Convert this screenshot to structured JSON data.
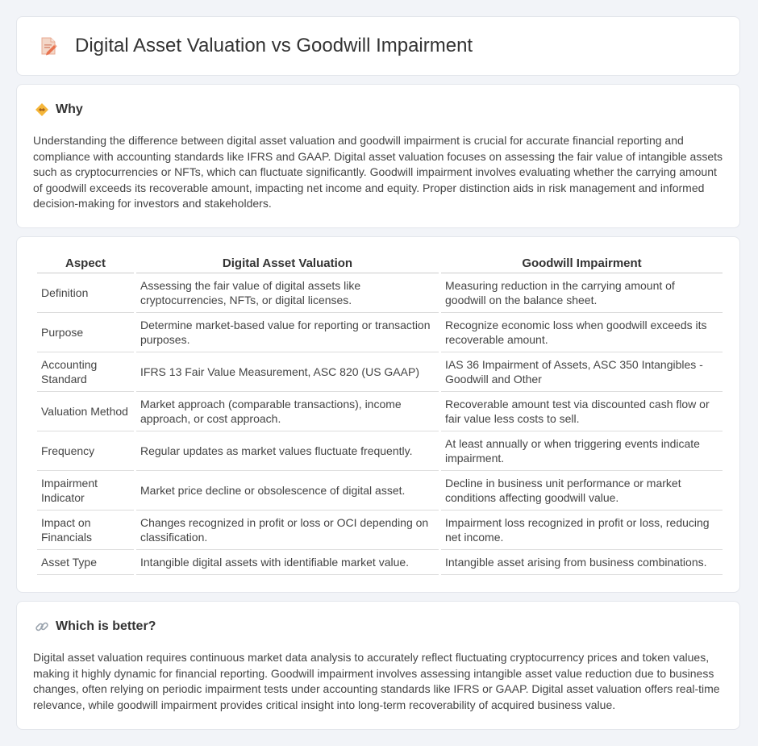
{
  "header": {
    "title": "Digital Asset Valuation vs Goodwill Impairment",
    "icon": "document-pencil-icon"
  },
  "why": {
    "title": "Why",
    "icon": "diamond-handshake-icon",
    "body": "Understanding the difference between digital asset valuation and goodwill impairment is crucial for accurate financial reporting and compliance with accounting standards like IFRS and GAAP. Digital asset valuation focuses on assessing the fair value of intangible assets such as cryptocurrencies or NFTs, which can fluctuate significantly. Goodwill impairment involves evaluating whether the carrying amount of goodwill exceeds its recoverable amount, impacting net income and equity. Proper distinction aids in risk management and informed decision-making for investors and stakeholders."
  },
  "table": {
    "headers": [
      "Aspect",
      "Digital Asset Valuation",
      "Goodwill Impairment"
    ],
    "rows": [
      [
        "Definition",
        "Assessing the fair value of digital assets like cryptocurrencies, NFTs, or digital licenses.",
        "Measuring reduction in the carrying amount of goodwill on the balance sheet."
      ],
      [
        "Purpose",
        "Determine market-based value for reporting or transaction purposes.",
        "Recognize economic loss when goodwill exceeds its recoverable amount."
      ],
      [
        "Accounting Standard",
        "IFRS 13 Fair Value Measurement, ASC 820 (US GAAP)",
        "IAS 36 Impairment of Assets, ASC 350 Intangibles - Goodwill and Other"
      ],
      [
        "Valuation Method",
        "Market approach (comparable transactions), income approach, or cost approach.",
        "Recoverable amount test via discounted cash flow or fair value less costs to sell."
      ],
      [
        "Frequency",
        "Regular updates as market values fluctuate frequently.",
        "At least annually or when triggering events indicate impairment."
      ],
      [
        "Impairment Indicator",
        "Market price decline or obsolescence of digital asset.",
        "Decline in business unit performance or market conditions affecting goodwill value."
      ],
      [
        "Impact on Financials",
        "Changes recognized in profit or loss or OCI depending on classification.",
        "Impairment loss recognized in profit or loss, reducing net income."
      ],
      [
        "Asset Type",
        "Intangible digital assets with identifiable market value.",
        "Intangible asset arising from business combinations."
      ]
    ]
  },
  "better": {
    "title": "Which is better?",
    "icon": "link-icon",
    "body": "Digital asset valuation requires continuous market data analysis to accurately reflect fluctuating cryptocurrency prices and token values, making it highly dynamic for financial reporting. Goodwill impairment involves assessing intangible asset value reduction due to business changes, often relying on periodic impairment tests under accounting standards like IFRS or GAAP. Digital asset valuation offers real-time relevance, while goodwill impairment provides critical insight into long-term recoverability of acquired business value."
  }
}
